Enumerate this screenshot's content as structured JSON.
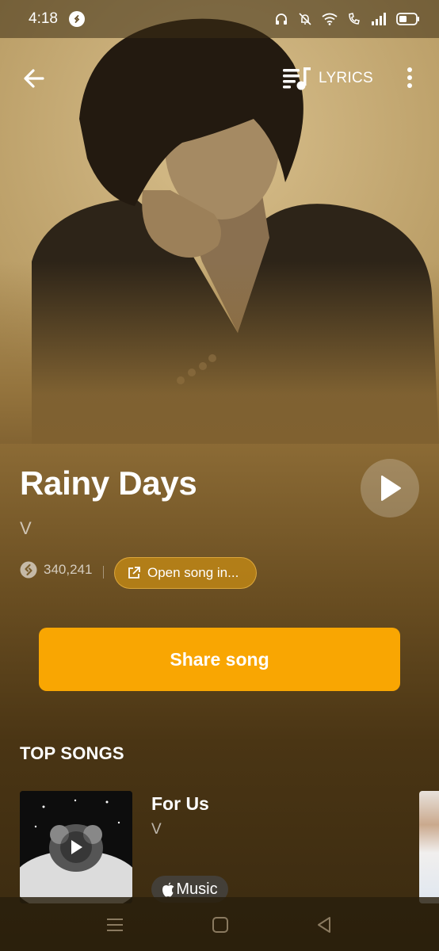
{
  "status_bar": {
    "time": "4:18"
  },
  "app_bar": {
    "lyrics_label": "LYRICS"
  },
  "song": {
    "title": "Rainy Days",
    "artist": "V",
    "shazam_count": "340,241",
    "open_label": "Open song in..."
  },
  "actions": {
    "share_label": "Share song"
  },
  "top_songs": {
    "heading": "TOP SONGS",
    "items": [
      {
        "title": "For Us",
        "artist": "V",
        "provider_label": "Music"
      }
    ]
  },
  "colors": {
    "accent": "#f9a602",
    "background_top": "#c9ad78",
    "background_bottom": "#3a2a10"
  },
  "icons": {
    "back": "arrow-left-icon",
    "lyrics": "lyrics-icon",
    "more": "more-vert-icon",
    "play": "play-icon",
    "shazam": "shazam-icon",
    "open_external": "external-link-icon",
    "apple": "apple-icon"
  }
}
